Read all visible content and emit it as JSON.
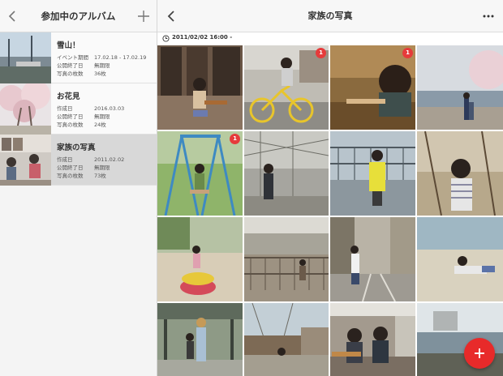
{
  "left_panel": {
    "title": "参加中のアルバム",
    "albums": [
      {
        "name": "雪山！",
        "rows": [
          {
            "key": "イベント期間",
            "value": "17.02.18 - 17.02.19"
          },
          {
            "key": "公開終了日",
            "value": "無期限"
          },
          {
            "key": "写真の枚数",
            "value": "36枚"
          }
        ],
        "selected": false
      },
      {
        "name": "お花見",
        "rows": [
          {
            "key": "作成日",
            "value": "2016.03.03"
          },
          {
            "key": "公開終了日",
            "value": "無期限"
          },
          {
            "key": "写真の枚数",
            "value": "24枚"
          }
        ],
        "selected": false
      },
      {
        "name": "家族の写真",
        "rows": [
          {
            "key": "作成日",
            "value": "2011.02.02"
          },
          {
            "key": "公開終了日",
            "value": "無期限"
          },
          {
            "key": "写真の枚数",
            "value": "73枚"
          }
        ],
        "selected": true
      }
    ]
  },
  "right_panel": {
    "title": "家族の写真",
    "date_label": "2011/02/02 16:00 -",
    "badges": [
      "1",
      "1",
      "1"
    ]
  },
  "colors": {
    "accent": "#e82a2a",
    "badge": "#e63b3b",
    "selected_row": "#d8d8d8"
  },
  "icons": [
    "back-chevron-icon",
    "plus-icon",
    "more-icon",
    "clock-icon",
    "add-icon"
  ]
}
